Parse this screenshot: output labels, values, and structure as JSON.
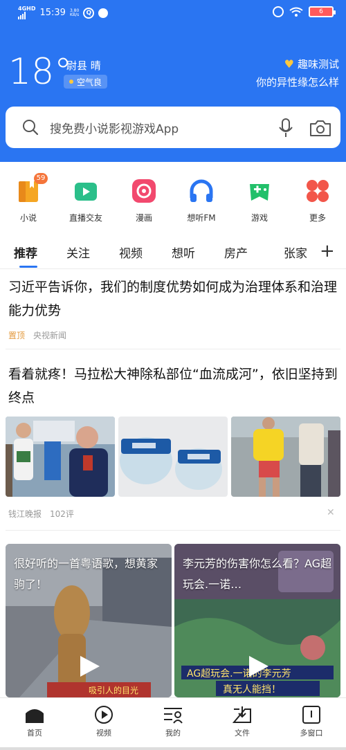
{
  "statusbar": {
    "network": "4GHD",
    "time": "15:39",
    "speed_value": "3.80",
    "speed_unit": "KB/s",
    "battery": "6"
  },
  "weather": {
    "temperature": "18°",
    "location": "尉县 晴",
    "air_quality": "空气良"
  },
  "promo": {
    "title": "趣味测试",
    "subtitle": "你的异性缘怎么样"
  },
  "search": {
    "placeholder": "搜免费小说影视游戏App"
  },
  "shortcuts": [
    {
      "label": "小说",
      "badge": "59",
      "icon": "book-icon"
    },
    {
      "label": "直播交友",
      "icon": "live-icon"
    },
    {
      "label": "漫画",
      "icon": "comic-icon"
    },
    {
      "label": "想听FM",
      "icon": "headphone-icon"
    },
    {
      "label": "游戏",
      "icon": "gamepad-icon"
    },
    {
      "label": "更多",
      "icon": "more-icon"
    }
  ],
  "tabs": [
    {
      "label": "推荐"
    },
    {
      "label": "关注"
    },
    {
      "label": "视频"
    },
    {
      "label": "想听"
    },
    {
      "label": "房产"
    },
    {
      "label": "张家"
    }
  ],
  "articles": [
    {
      "title": "习近平告诉你，我们的制度优势如何成为治理体系和治理能力优势",
      "tag": "置顶",
      "source": "央视新闻"
    },
    {
      "title": "看着就疼！马拉松大神除私部位“血流成河”，依旧坚持到终点",
      "source": "钱江晚报",
      "comments": "102评"
    }
  ],
  "videos": [
    {
      "title": "很好听的一首粤语歌，想黄家驹了！"
    },
    {
      "title": "李元芳的伤害你怎么看？AG超玩会.一诺…"
    }
  ],
  "bottom_nav": [
    {
      "label": "首页",
      "icon": "home-icon"
    },
    {
      "label": "视频",
      "icon": "play-circle-icon"
    },
    {
      "label": "我的",
      "icon": "profile-icon"
    },
    {
      "label": "文件",
      "icon": "download-folder-icon"
    },
    {
      "label": "多窗口",
      "icon": "window-icon"
    }
  ],
  "colors": {
    "brand_blue": "#2a75f2",
    "tab_indicator": "#2a75f2",
    "badge_orange": "#f5753a"
  }
}
